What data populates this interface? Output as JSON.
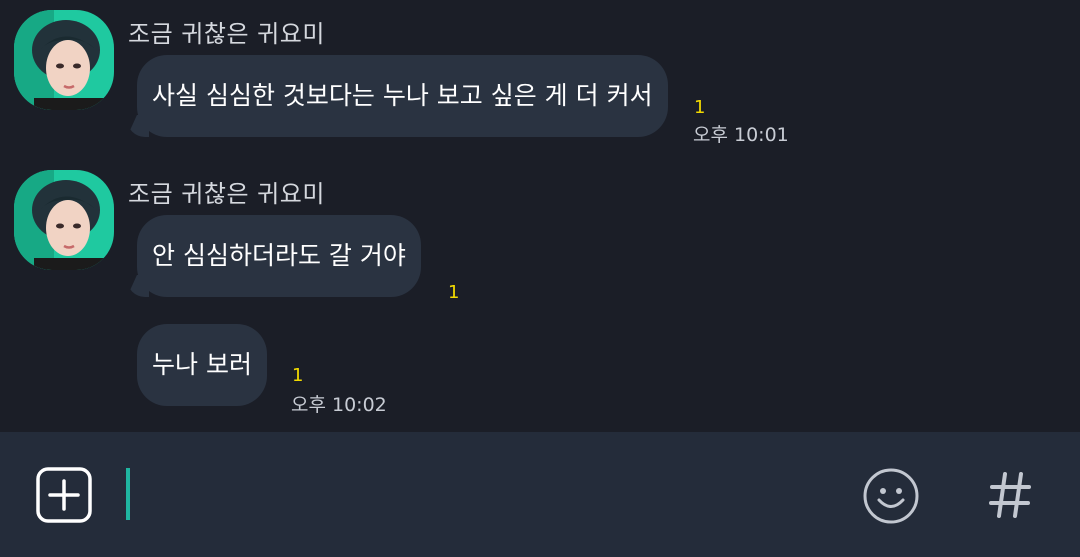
{
  "messages": [
    {
      "sender": "조금 귀찮은 귀요미",
      "text": "사실 심심한 것보다는 누나 보고 싶은 게 더 커서",
      "unread": "1",
      "time": "오후 10:01"
    },
    {
      "sender": "조금 귀찮은 귀요미",
      "text": "안 심심하더라도 갈 거야",
      "unread": "1"
    },
    {
      "text": "누나 보러",
      "unread": "1",
      "time": "오후 10:02"
    }
  ],
  "input_bar": {
    "icons": {
      "attach": "plus-square-icon",
      "emoji": "smiley-icon",
      "hashtag": "hashtag-icon"
    }
  },
  "colors": {
    "background": "#1b1e27",
    "bubble": "#2a3341",
    "unread": "#f1d900",
    "input_bar": "#242c3a",
    "cursor": "#1fb5a0"
  }
}
